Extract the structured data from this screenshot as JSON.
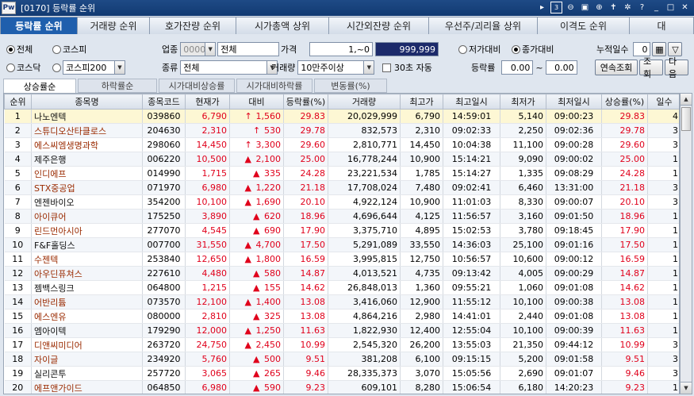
{
  "window": {
    "screen_no": "[0170]",
    "title": "등락률 순위",
    "logo": "Pw",
    "page_no": "3"
  },
  "tabs": [
    {
      "label": "등락률 순위",
      "active": true
    },
    {
      "label": "거래량 순위"
    },
    {
      "label": "호가잔량 순위"
    },
    {
      "label": "시가총액 상위"
    },
    {
      "label": "시간외잔량 순위"
    },
    {
      "label": "우선주/괴리율 상위"
    },
    {
      "label": "이격도 순위"
    },
    {
      "label": "대"
    }
  ],
  "filters": {
    "all": "전체",
    "kospi": "코스피",
    "kosdaq": "코스닥",
    "index_select": "코스피200",
    "industry_label": "업종",
    "industry_code": "0000",
    "industry_name": "전체",
    "kind_label": "종류",
    "kind_value": "전체",
    "price_label": "가격",
    "price_from": "1,",
    "price_sep": "~0",
    "price_to": "999,999",
    "volume_label": "거래량",
    "volume_value": "10만주이상",
    "auto_label": "30초 자동",
    "vs_low": "저가대비",
    "vs_close": "종가대비",
    "change_label": "등락률",
    "change_from": "0.00",
    "change_sep": "~",
    "change_to": "0.00",
    "days_label": "누적일수",
    "days_value": "0",
    "continuous_button": "연속조회",
    "query_button": "조회",
    "next_button": "다음"
  },
  "subtabs": [
    {
      "label": "상승률순",
      "active": true
    },
    {
      "label": "하락률순"
    },
    {
      "label": "시가대비상승률"
    },
    {
      "label": "시가대비하락률"
    },
    {
      "label": "변동률(%)"
    }
  ],
  "columns": [
    "순위",
    "종목명",
    "종목코드",
    "현재가",
    "대비",
    "등락률(%)",
    "거래량",
    "최고가",
    "최고일시",
    "최저가",
    "최저일시",
    "상승률(%)",
    "일수"
  ],
  "rows": [
    {
      "rank": "1",
      "name": "나노엔텍",
      "code": "039860",
      "price": "6,790",
      "arrow": "up_limit",
      "change": "1,560",
      "rate": "29.83",
      "volume": "20,029,999",
      "high": "6,790",
      "high_time": "14:59:01",
      "low": "5,140",
      "low_time": "09:00:23",
      "rise": "29.83",
      "days": "4"
    },
    {
      "rank": "2",
      "name": "스튜디오산타클로스",
      "code": "204630",
      "price": "2,310",
      "arrow": "up_limit",
      "change": "530",
      "rate": "29.78",
      "volume": "832,573",
      "high": "2,310",
      "high_time": "09:02:33",
      "low": "2,250",
      "low_time": "09:02:36",
      "rise": "29.78",
      "days": "3"
    },
    {
      "rank": "3",
      "name": "에스씨엠생명과학",
      "code": "298060",
      "price": "14,450",
      "arrow": "up_limit",
      "change": "3,300",
      "rate": "29.60",
      "volume": "2,810,771",
      "high": "14,450",
      "high_time": "10:04:38",
      "low": "11,100",
      "low_time": "09:00:28",
      "rise": "29.60",
      "days": "3"
    },
    {
      "rank": "4",
      "name": "제주은행",
      "code": "006220",
      "price": "10,500",
      "arrow": "up",
      "change": "2,100",
      "rate": "25.00",
      "volume": "16,778,244",
      "high": "10,900",
      "high_time": "15:14:21",
      "low": "9,090",
      "low_time": "09:00:02",
      "rise": "25.00",
      "days": "1"
    },
    {
      "rank": "5",
      "name": "인디에프",
      "code": "014990",
      "price": "1,715",
      "arrow": "up",
      "change": "335",
      "rate": "24.28",
      "volume": "23,221,534",
      "high": "1,785",
      "high_time": "15:14:27",
      "low": "1,335",
      "low_time": "09:08:29",
      "rise": "24.28",
      "days": "1"
    },
    {
      "rank": "6",
      "name": "STX중공업",
      "code": "071970",
      "price": "6,980",
      "arrow": "up",
      "change": "1,220",
      "rate": "21.18",
      "volume": "17,708,024",
      "high": "7,480",
      "high_time": "09:02:41",
      "low": "6,460",
      "low_time": "13:31:00",
      "rise": "21.18",
      "days": "3"
    },
    {
      "rank": "7",
      "name": "엔젠바이오",
      "code": "354200",
      "price": "10,100",
      "arrow": "up",
      "change": "1,690",
      "rate": "20.10",
      "volume": "4,922,124",
      "high": "10,900",
      "high_time": "11:01:03",
      "low": "8,330",
      "low_time": "09:00:07",
      "rise": "20.10",
      "days": "3"
    },
    {
      "rank": "8",
      "name": "아이큐어",
      "code": "175250",
      "price": "3,890",
      "arrow": "up",
      "change": "620",
      "rate": "18.96",
      "volume": "4,696,644",
      "high": "4,125",
      "high_time": "11:56:57",
      "low": "3,160",
      "low_time": "09:01:50",
      "rise": "18.96",
      "days": "1"
    },
    {
      "rank": "9",
      "name": "린드먼아시아",
      "code": "277070",
      "price": "4,545",
      "arrow": "up",
      "change": "690",
      "rate": "17.90",
      "volume": "3,375,710",
      "high": "4,895",
      "high_time": "15:02:53",
      "low": "3,780",
      "low_time": "09:18:45",
      "rise": "17.90",
      "days": "1"
    },
    {
      "rank": "10",
      "name": "F&F홀딩스",
      "code": "007700",
      "price": "31,550",
      "arrow": "up",
      "change": "4,700",
      "rate": "17.50",
      "volume": "5,291,089",
      "high": "33,550",
      "high_time": "14:36:03",
      "low": "25,100",
      "low_time": "09:01:16",
      "rise": "17.50",
      "days": "1"
    },
    {
      "rank": "11",
      "name": "수젠텍",
      "code": "253840",
      "price": "12,650",
      "arrow": "up",
      "change": "1,800",
      "rate": "16.59",
      "volume": "3,995,815",
      "high": "12,750",
      "high_time": "10:56:57",
      "low": "10,600",
      "low_time": "09:00:12",
      "rise": "16.59",
      "days": "1"
    },
    {
      "rank": "12",
      "name": "아우딘퓨쳐스",
      "code": "227610",
      "price": "4,480",
      "arrow": "up",
      "change": "580",
      "rate": "14.87",
      "volume": "4,013,521",
      "high": "4,735",
      "high_time": "09:13:42",
      "low": "4,005",
      "low_time": "09:00:29",
      "rise": "14.87",
      "days": "1"
    },
    {
      "rank": "13",
      "name": "젬백스링크",
      "code": "064800",
      "price": "1,215",
      "arrow": "up",
      "change": "155",
      "rate": "14.62",
      "volume": "26,848,013",
      "high": "1,360",
      "high_time": "09:55:21",
      "low": "1,060",
      "low_time": "09:01:08",
      "rise": "14.62",
      "days": "1"
    },
    {
      "rank": "14",
      "name": "어반리튬",
      "code": "073570",
      "price": "12,100",
      "arrow": "up",
      "change": "1,400",
      "rate": "13.08",
      "volume": "3,416,060",
      "high": "12,900",
      "high_time": "11:55:12",
      "low": "10,100",
      "low_time": "09:00:38",
      "rise": "13.08",
      "days": "1"
    },
    {
      "rank": "15",
      "name": "에스엔유",
      "code": "080000",
      "price": "2,810",
      "arrow": "up",
      "change": "325",
      "rate": "13.08",
      "volume": "4,864,216",
      "high": "2,980",
      "high_time": "14:41:01",
      "low": "2,440",
      "low_time": "09:01:08",
      "rise": "13.08",
      "days": "1"
    },
    {
      "rank": "16",
      "name": "엠아이텍",
      "code": "179290",
      "price": "12,000",
      "arrow": "up",
      "change": "1,250",
      "rate": "11.63",
      "volume": "1,822,930",
      "high": "12,400",
      "high_time": "12:55:04",
      "low": "10,100",
      "low_time": "09:00:39",
      "rise": "11.63",
      "days": "1"
    },
    {
      "rank": "17",
      "name": "디앤씨미디어",
      "code": "263720",
      "price": "24,750",
      "arrow": "up",
      "change": "2,450",
      "rate": "10.99",
      "volume": "2,545,320",
      "high": "26,200",
      "high_time": "13:55:03",
      "low": "21,350",
      "low_time": "09:44:12",
      "rise": "10.99",
      "days": "3"
    },
    {
      "rank": "18",
      "name": "자이글",
      "code": "234920",
      "price": "5,760",
      "arrow": "up",
      "change": "500",
      "rate": "9.51",
      "volume": "381,208",
      "high": "6,100",
      "high_time": "09:15:15",
      "low": "5,200",
      "low_time": "09:01:58",
      "rise": "9.51",
      "days": "3"
    },
    {
      "rank": "19",
      "name": "실리콘투",
      "code": "257720",
      "price": "3,065",
      "arrow": "up",
      "change": "265",
      "rate": "9.46",
      "volume": "28,335,373",
      "high": "3,070",
      "high_time": "15:05:56",
      "low": "2,690",
      "low_time": "09:01:07",
      "rise": "9.46",
      "days": "3"
    },
    {
      "rank": "20",
      "name": "에프앤가이드",
      "code": "064850",
      "price": "6,980",
      "arrow": "up",
      "change": "590",
      "rate": "9.23",
      "volume": "609,101",
      "high": "8,280",
      "high_time": "15:06:54",
      "low": "6,180",
      "low_time": "14:20:23",
      "rise": "9.23",
      "days": "1"
    }
  ],
  "icons": {
    "up_limit": "arrow-up-icon",
    "up": "triangle-up-icon"
  },
  "colors": {
    "up": "#e0001b",
    "tab_active": "#1f5fad",
    "titlebar": "#1e4a86"
  }
}
